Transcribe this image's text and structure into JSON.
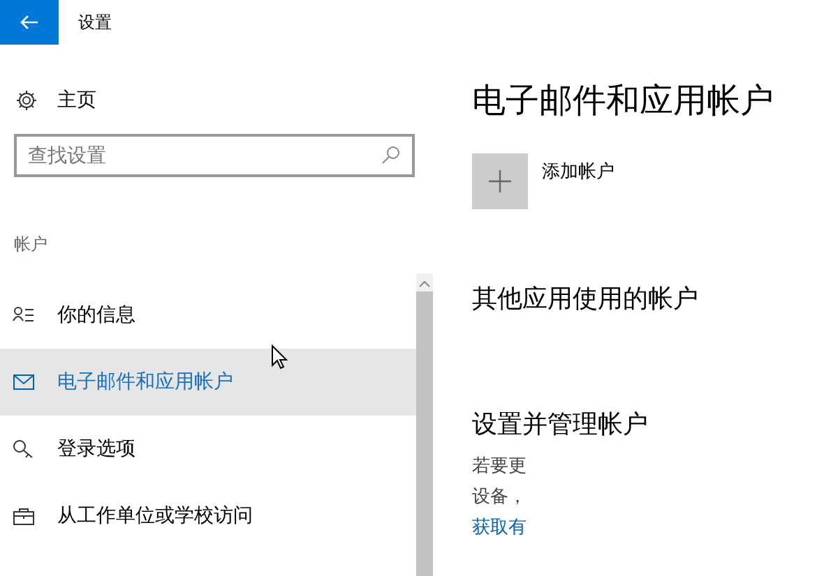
{
  "window": {
    "title": "设置"
  },
  "sidebar": {
    "home": "主页",
    "search": {
      "placeholder": "查找设置"
    },
    "section": "帐户",
    "items": [
      {
        "label": "你的信息",
        "kind": "person",
        "selected": false
      },
      {
        "label": "电子邮件和应用帐户",
        "kind": "mail",
        "selected": true
      },
      {
        "label": "登录选项",
        "kind": "key",
        "selected": false
      },
      {
        "label": "从工作单位或学校访问",
        "kind": "briefcase",
        "selected": false
      }
    ]
  },
  "content": {
    "title": "电子邮件和应用帐户",
    "add_account": "添加帐户",
    "sections": [
      {
        "heading": "其他应用使用的帐户"
      },
      {
        "heading": "设置并管理帐户",
        "lines": [
          {
            "text": "若要更",
            "kind": "text"
          },
          {
            "text": "设备，",
            "kind": "text"
          },
          {
            "text": "获取有",
            "kind": "link"
          }
        ]
      }
    ]
  }
}
